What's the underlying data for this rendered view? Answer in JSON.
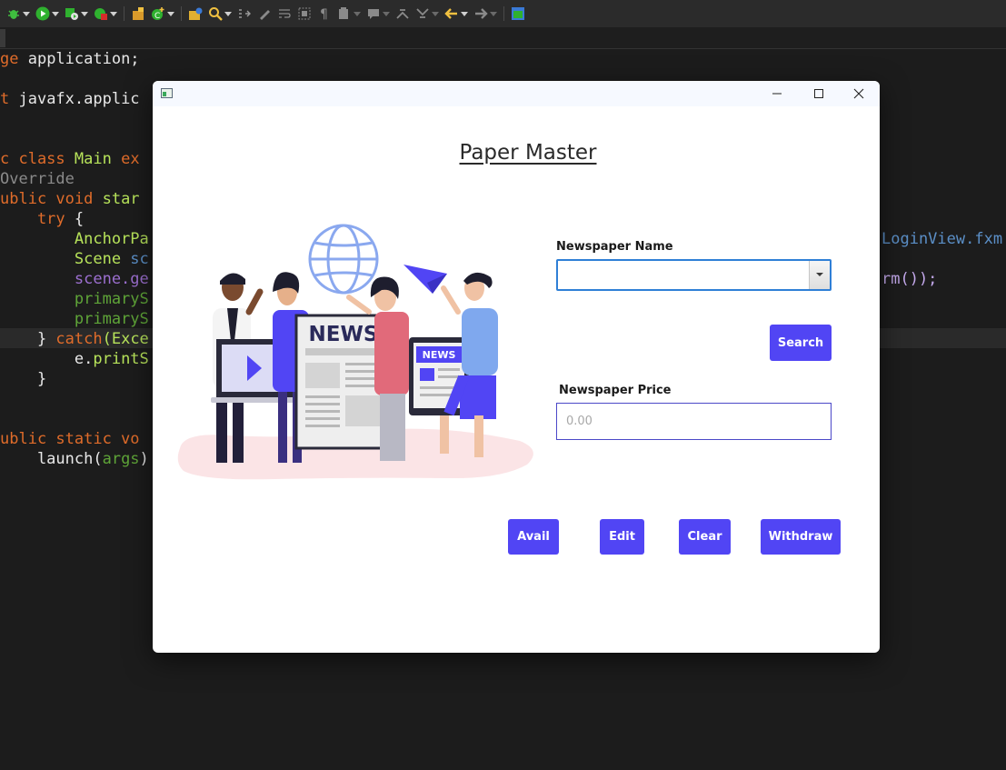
{
  "toolbar": {
    "icons": [
      "debug-icon",
      "run-icon",
      "run-as-icon",
      "stop-icon",
      "new-package-icon",
      "new-class-icon",
      "open-type-icon",
      "search-icon",
      "link-icon",
      "edit-icon",
      "wrap-icon",
      "block-select-icon",
      "show-whitespace-icon",
      "annotation-icon",
      "comment-icon",
      "previous-annotation-icon",
      "next-annotation-icon",
      "back-icon",
      "forward-icon",
      "perspective-icon"
    ]
  },
  "code": {
    "lines": [
      {
        "parts": [
          {
            "t": "ge ",
            "c": "kw2"
          },
          {
            "t": "application;",
            "c": "fn"
          }
        ]
      },
      {
        "parts": [
          {
            "t": "t ",
            "c": "kw2"
          },
          {
            "t": "javafx.applic",
            "c": "fn"
          }
        ]
      },
      {
        "parts": [
          {
            "t": "c class ",
            "c": "kw2"
          },
          {
            "t": "Main ",
            "c": "ty"
          },
          {
            "t": "ex",
            "c": "kw2"
          }
        ]
      },
      {
        "parts": [
          {
            "t": "Override",
            "c": "ann"
          }
        ]
      },
      {
        "parts": [
          {
            "t": "ublic void ",
            "c": "kw2"
          },
          {
            "t": "star",
            "c": "ty"
          }
        ]
      },
      {
        "parts": [
          {
            "t": "    try ",
            "c": "kw2"
          },
          {
            "t": "{",
            "c": "fn"
          }
        ]
      },
      {
        "parts": [
          {
            "t": "        AnchorPa",
            "c": "ty"
          }
        ]
      },
      {
        "parts": [
          {
            "t": "        Scene ",
            "c": "ty"
          },
          {
            "t": "sc",
            "c": "str"
          }
        ]
      },
      {
        "parts": [
          {
            "t": "        scene.ge",
            "c": "var"
          }
        ]
      },
      {
        "parts": [
          {
            "t": "        primaryS",
            "c": "fld"
          }
        ]
      },
      {
        "parts": [
          {
            "t": "        primaryS",
            "c": "fld"
          }
        ]
      },
      {
        "parts": [
          {
            "t": "    } ",
            "c": "fn"
          },
          {
            "t": "catch",
            "c": "kw2"
          },
          {
            "t": "(Exce",
            "c": "ty"
          }
        ]
      },
      {
        "parts": [
          {
            "t": "        e.",
            "c": "fn"
          },
          {
            "t": "printS",
            "c": "ty"
          }
        ]
      },
      {
        "parts": [
          {
            "t": "    }",
            "c": "fn"
          }
        ]
      },
      {
        "parts": [
          {
            "t": "",
            "c": "fn"
          }
        ]
      },
      {
        "parts": [
          {
            "t": "ublic static vo",
            "c": "kw2"
          }
        ]
      },
      {
        "parts": [
          {
            "t": "    launch(",
            "c": "fn"
          },
          {
            "t": "args",
            "c": "fld"
          },
          {
            "t": ")",
            "c": "fn"
          }
        ]
      }
    ],
    "right_fragments": [
      {
        "text": "LoginView.fxm",
        "row": 6,
        "color": "str"
      },
      {
        "text": "rm());",
        "row": 8,
        "color": "mth"
      }
    ]
  },
  "window": {
    "title": "",
    "controls": [
      "minimize-icon",
      "maximize-icon",
      "close-icon"
    ]
  },
  "form": {
    "title": "Paper Master",
    "illustration_sign": "NEWS",
    "newspaper_name_label": "Newspaper Name",
    "newspaper_name_value": "",
    "search_label": "Search",
    "newspaper_price_label": "Newspaper Price",
    "newspaper_price_placeholder": "0.00",
    "buttons": {
      "avail": "Avail",
      "edit": "Edit",
      "clear": "Clear",
      "withdraw": "Withdraw"
    }
  },
  "colors": {
    "accent": "#5145f4",
    "focus_border": "#2f7fd6",
    "ide_background": "#1c1c1c"
  }
}
